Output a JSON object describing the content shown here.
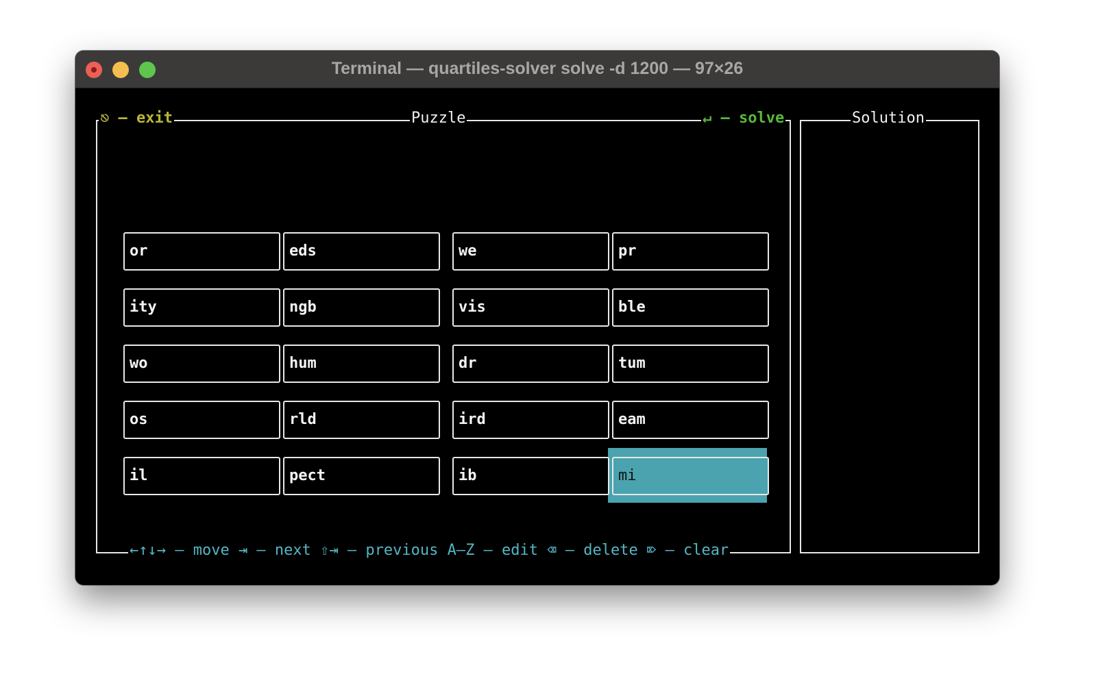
{
  "window": {
    "title": "Terminal — quartiles-solver solve -d 1200 — 97×26"
  },
  "puzzle": {
    "title": "Puzzle",
    "exit_hint": "⎋ – exit",
    "solve_hint": "↵ – solve",
    "help_line": "←↑↓→ – move ⇥ – next ⇧⇥ – previous A–Z – edit ⌫ – delete ⌦ – clear",
    "selected_tile": "mi",
    "tiles": [
      [
        "or",
        "eds",
        "we",
        "pr"
      ],
      [
        "ity",
        "ngb",
        "vis",
        "ble"
      ],
      [
        "wo",
        "hum",
        "dr",
        "tum"
      ],
      [
        "os",
        "rld",
        "ird",
        "eam"
      ],
      [
        "il",
        "pect",
        "ib",
        "mi"
      ]
    ]
  },
  "solution": {
    "title": "Solution",
    "words": []
  },
  "colors": {
    "exit_hint": "#b8b73a",
    "solve_hint": "#59b83a",
    "help_text": "#54b6c4",
    "selection": "#4aa3af"
  }
}
